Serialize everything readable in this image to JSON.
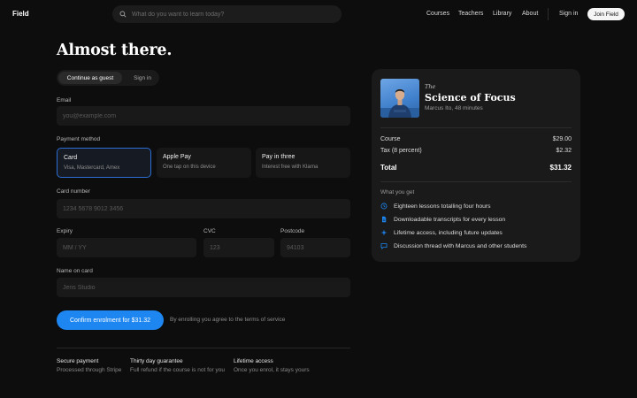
{
  "nav": {
    "logo": "Field",
    "search_placeholder": "What do you want to learn today?",
    "links": [
      "Courses",
      "Teachers",
      "Library",
      "About"
    ],
    "sign_in": "Sign in",
    "join": "Join Field"
  },
  "checkout": {
    "title": "Almost there.",
    "toggle": [
      "Continue as guest",
      "Sign in"
    ],
    "email_label": "Email",
    "email_placeholder": "you@example.com",
    "payment_label": "Payment method",
    "methods": [
      {
        "title": "Card",
        "sub": "Visa, Mastercard, Amex"
      },
      {
        "title": "Apple Pay",
        "sub": "One tap on this device"
      },
      {
        "title": "Pay in three",
        "sub": "Interest free with Klarna"
      }
    ],
    "card_number_label": "Card number",
    "card_number_placeholder": "1234 5678 9012 3456",
    "expiry_label": "Expiry",
    "expiry_placeholder": "MM / YY",
    "cvc_label": "CVC",
    "cvc_placeholder": "123",
    "postcode_label": "Postcode",
    "postcode_placeholder": "94103",
    "name_label": "Name on card",
    "name_placeholder": "Jens Studio",
    "confirm": "Confirm enrolment for $31.32",
    "terms": "By enrolling you agree to the terms of service",
    "features": [
      {
        "title": "Secure payment",
        "sub": "Processed through Stripe"
      },
      {
        "title": "Thirty day guarantee",
        "sub": "Full refund if the course is not for you"
      },
      {
        "title": "Lifetime access",
        "sub": "Once you enrol, it stays yours"
      }
    ]
  },
  "summary": {
    "eyebrow": "The",
    "course": "Science of Focus",
    "meta": "Marcus Ito, 48 minutes",
    "course_label": "Course",
    "course_price": "$29.00",
    "tax_label": "Tax (8 percent)",
    "tax_price": "$2.32",
    "total_label": "Total",
    "total_price": "$31.32",
    "what_you_get": "What you get",
    "benefits": [
      {
        "icon": "clock-icon",
        "text": "Eighteen lessons totalling four hours"
      },
      {
        "icon": "document-icon",
        "text": "Downloadable transcripts for every lesson"
      },
      {
        "icon": "sparkle-icon",
        "text": "Lifetime access, including future updates"
      },
      {
        "icon": "chat-icon",
        "text": "Discussion thread with Marcus and other students"
      }
    ],
    "accent": "#1d86f0"
  }
}
